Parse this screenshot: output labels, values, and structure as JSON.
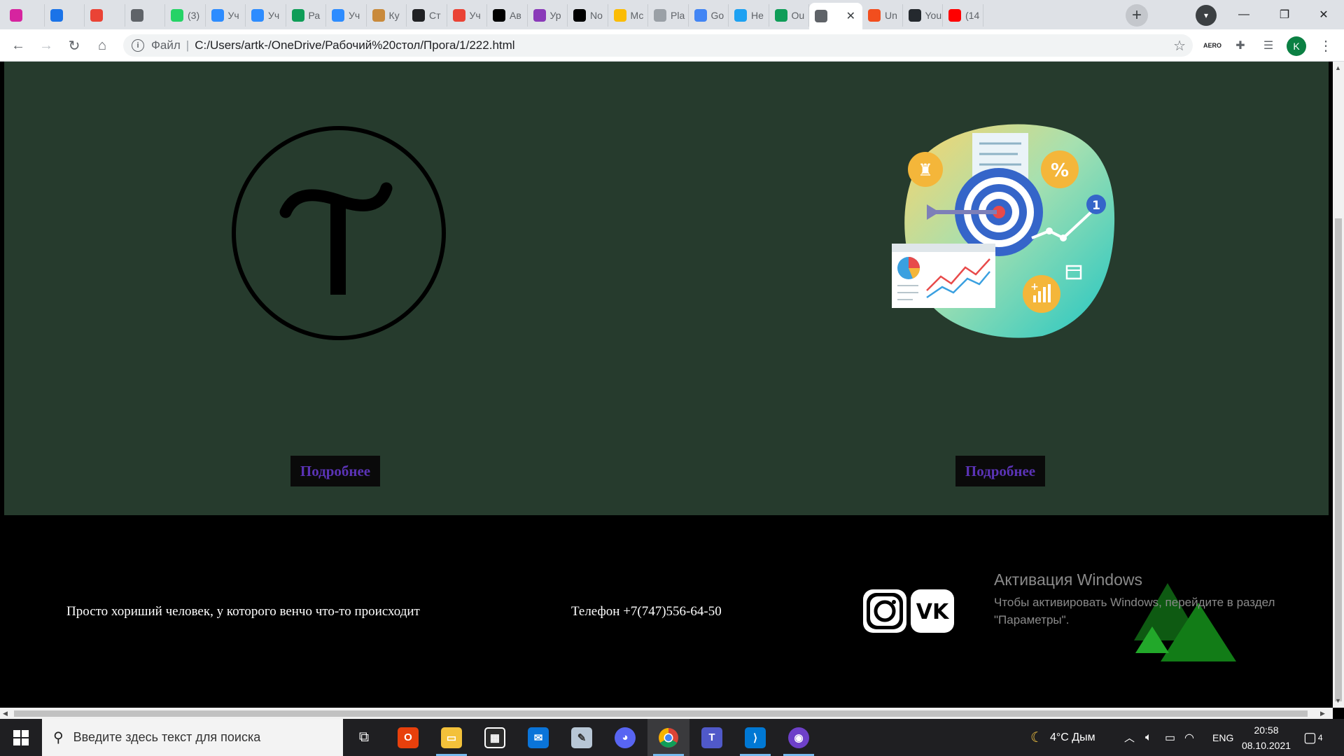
{
  "tabs": [
    {
      "title": "",
      "icon": "instagram-icon",
      "color": "#d6249f"
    },
    {
      "title": "",
      "icon": "chat-icon",
      "color": "#1a73e8"
    },
    {
      "title": "",
      "icon": "gmail-icon",
      "color": "#ea4335"
    },
    {
      "title": "",
      "icon": "circle-icon",
      "color": "#5f6368"
    },
    {
      "title": "(3)",
      "icon": "whatsapp-icon",
      "color": "#25d366"
    },
    {
      "title": "Уч",
      "icon": "zoom-icon",
      "color": "#2d8cff"
    },
    {
      "title": "Уч",
      "icon": "zoom-icon",
      "color": "#2d8cff"
    },
    {
      "title": "Ра",
      "icon": "sheets-icon",
      "color": "#0f9d58"
    },
    {
      "title": "Уч",
      "icon": "zoom-icon",
      "color": "#2d8cff"
    },
    {
      "title": "Ку",
      "icon": "hand-icon",
      "color": "#c98a3c"
    },
    {
      "title": "Ст",
      "icon": "gc-icon",
      "color": "#202124"
    },
    {
      "title": "Уч",
      "icon": "gmail-icon",
      "color": "#ea4335"
    },
    {
      "title": "Ав",
      "icon": "notion-n-icon",
      "color": "#000000"
    },
    {
      "title": "Ур",
      "icon": "instagram-icon",
      "color": "#8a3ab9"
    },
    {
      "title": "No",
      "icon": "notion-icon",
      "color": "#000000"
    },
    {
      "title": "Мс",
      "icon": "drive-icon",
      "color": "#fbbc04"
    },
    {
      "title": "Pla",
      "icon": "building-icon",
      "color": "#9aa0a6"
    },
    {
      "title": "Go",
      "icon": "translate-icon",
      "color": "#4285f4"
    },
    {
      "title": "Не",
      "icon": "compass-icon",
      "color": "#1da1f2"
    },
    {
      "title": "Ou",
      "icon": "sheets-icon",
      "color": "#0f9d58"
    },
    {
      "title": "",
      "icon": "globe-icon",
      "color": "#5f6368",
      "active": true
    },
    {
      "title": "Un",
      "icon": "figma-icon",
      "color": "#f24e1e"
    },
    {
      "title": "You",
      "icon": "github-icon",
      "color": "#24292e"
    },
    {
      "title": "(14",
      "icon": "youtube-icon",
      "color": "#ff0000"
    }
  ],
  "address": {
    "scheme_label": "Файл",
    "url": "C:/Users/artk-/OneDrive/Рабочий%20стол/Прога/1/222.html"
  },
  "profile_initial": "K",
  "page": {
    "more_button_left": "Подробнее",
    "more_button_right": "Подробнее",
    "footer_tagline": "Просто хориший человек, у которого венчо что-то происходит",
    "footer_phone": "Телефон +7(747)556-64-50"
  },
  "watermark": {
    "title": "Активация Windows",
    "subtitle": "Чтобы активировать Windows, перейдите в раздел \"Параметры\"."
  },
  "taskbar": {
    "search_placeholder": "Введите здесь текст для поиска",
    "weather": "4°C Дым",
    "language": "ENG",
    "time": "20:58",
    "date": "08.10.2021",
    "notifications": "4"
  },
  "colors": {
    "page_green": "#263b2d",
    "button_text": "#5a33b5",
    "footer_bg": "#000000"
  }
}
